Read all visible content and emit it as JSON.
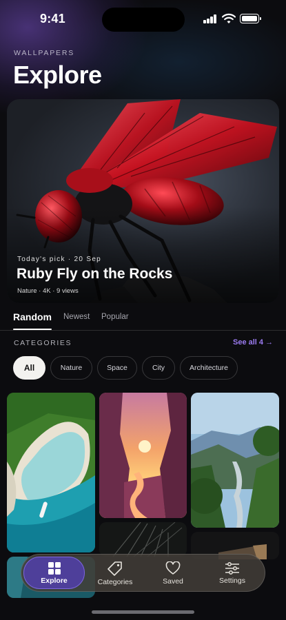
{
  "status_bar": {
    "time": "9:41"
  },
  "header": {
    "eyebrow": "WALLPAPERS",
    "title": "Explore"
  },
  "hero": {
    "kicker": "Today's pick · 20 Sep",
    "title": "Ruby Fly on the Rocks",
    "meta": "Nature · 4K · 9 views"
  },
  "tabs": [
    {
      "label": "Random",
      "active": true
    },
    {
      "label": "Newest",
      "active": false
    },
    {
      "label": "Popular",
      "active": false
    }
  ],
  "categories": {
    "label": "CATEGORIES",
    "see_all": "See all 4 →",
    "chips": [
      {
        "label": "All",
        "active": true
      },
      {
        "label": "Nature",
        "active": false
      },
      {
        "label": "Space",
        "active": false
      },
      {
        "label": "City",
        "active": false
      },
      {
        "label": "Architecture",
        "active": false
      }
    ]
  },
  "gallery": [
    {
      "subject": "aerial-coast",
      "icon": "beach-image"
    },
    {
      "subject": "canyon-sunset",
      "icon": "canyon-image"
    },
    {
      "subject": "mountain-valley",
      "icon": "valley-image"
    },
    {
      "subject": "palm-leaves",
      "icon": "palm-image"
    },
    {
      "subject": "dark-architecture",
      "icon": "architecture-image"
    },
    {
      "subject": "coast-partial",
      "icon": "coast-image"
    }
  ],
  "nav": [
    {
      "label": "Explore",
      "icon": "grid-icon",
      "active": true
    },
    {
      "label": "Categories",
      "icon": "tag-icon",
      "active": false
    },
    {
      "label": "Saved",
      "icon": "heart-icon",
      "active": false
    },
    {
      "label": "Settings",
      "icon": "sliders-icon",
      "active": false
    }
  ],
  "colors": {
    "accent": "#7c66e0",
    "see_all": "#9b7bf0",
    "active_chip": "#f3f2ef"
  }
}
